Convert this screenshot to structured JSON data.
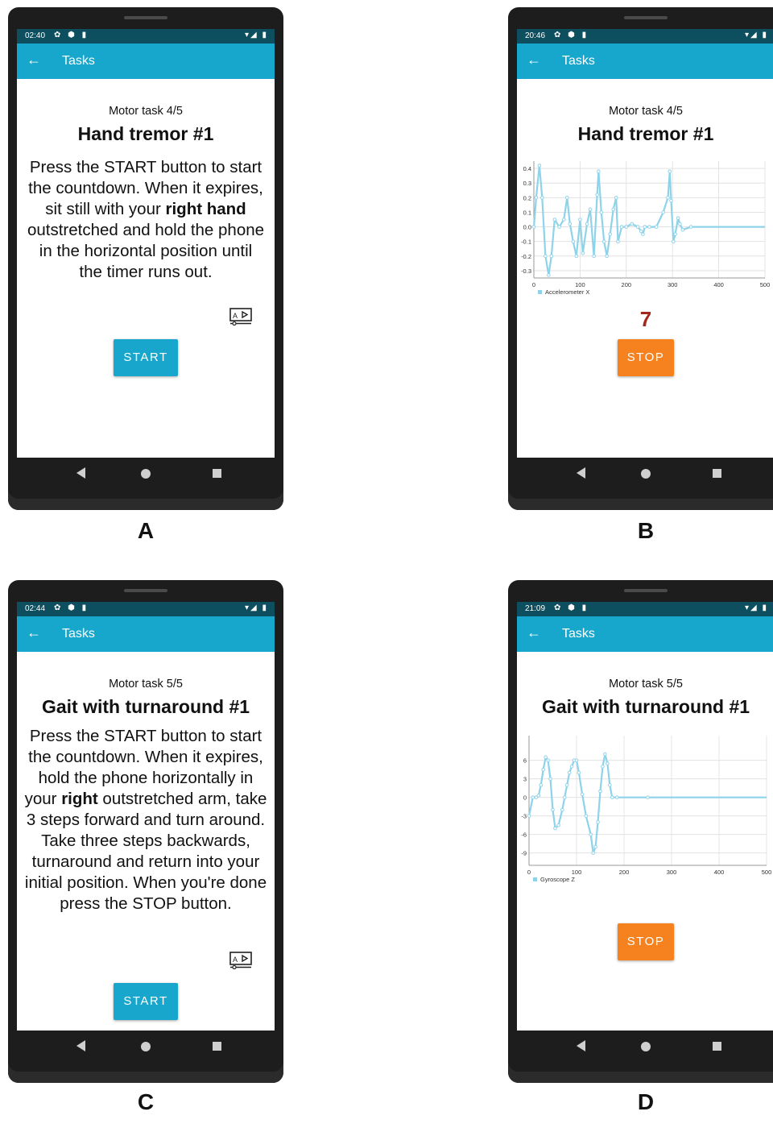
{
  "panels": [
    {
      "label": "A",
      "status_time": "02:40",
      "status_icons": "✿ ⬢ ▮",
      "status_right": "▾◢ ▮",
      "app_title": "Tasks",
      "subtitle": "Motor task 4/5",
      "title": "Hand tremor #1",
      "instruction_html": "Press the START button to start the countdown. When it expires, sit still with your <b>right hand</b> outstretched and hold the phone in the horizontal position until the timer runs out.",
      "button_label": "START"
    },
    {
      "label": "B",
      "status_time": "20:46",
      "status_icons": "✿ ⬢ ▮",
      "status_right": "▾◢ ▮",
      "app_title": "Tasks",
      "subtitle": "Motor task 4/5",
      "title": "Hand tremor #1",
      "countdown": "7",
      "button_label": "STOP"
    },
    {
      "label": "C",
      "status_time": "02:44",
      "status_icons": "✿ ⬢ ▮",
      "status_right": "▾◢ ▮",
      "app_title": "Tasks",
      "subtitle": "Motor task 5/5",
      "title": "Gait with turnaround #1",
      "instruction_html": "Press the START button to start the countdown. When it expires, hold the phone horizontally in your <b>right</b> outstretched arm, take 3 steps forward and turn around. Take three steps backwards, turnaround and return into your initial position. When you're done press the STOP button.",
      "button_label": "START"
    },
    {
      "label": "D",
      "status_time": "21:09",
      "status_icons": "✿ ⬢ ▮",
      "status_right": "▾◢ ▮",
      "app_title": "Tasks",
      "subtitle": "Motor task 5/5",
      "title": "Gait with turnaround #1",
      "button_label": "STOP"
    }
  ],
  "colors": {
    "appbar": "#17a6cc",
    "statusbar": "#0d4f5f",
    "start_button": "#19a6cc",
    "stop_button": "#f6821f",
    "countdown": "#a3291f",
    "series": "#8fd3ea"
  },
  "icons": {
    "back": "arrow-left-icon",
    "video": "video-tutorial-icon"
  },
  "chart_data": [
    {
      "type": "line",
      "panel": "B",
      "series": [
        {
          "name": "Accelerometer X",
          "points": [
            [
              0,
              0.0
            ],
            [
              5,
              0.2
            ],
            [
              12,
              0.42
            ],
            [
              18,
              0.2
            ],
            [
              25,
              -0.2
            ],
            [
              32,
              -0.33
            ],
            [
              38,
              -0.2
            ],
            [
              45,
              0.05
            ],
            [
              55,
              0.0
            ],
            [
              65,
              0.05
            ],
            [
              72,
              0.2
            ],
            [
              78,
              0.02
            ],
            [
              85,
              -0.1
            ],
            [
              92,
              -0.2
            ],
            [
              100,
              0.05
            ],
            [
              106,
              -0.18
            ],
            [
              115,
              0.02
            ],
            [
              122,
              0.12
            ],
            [
              130,
              -0.2
            ],
            [
              137,
              0.22
            ],
            [
              140,
              0.38
            ],
            [
              146,
              0.1
            ],
            [
              152,
              -0.1
            ],
            [
              158,
              -0.2
            ],
            [
              165,
              -0.05
            ],
            [
              172,
              0.12
            ],
            [
              178,
              0.2
            ],
            [
              182,
              -0.1
            ],
            [
              190,
              0.0
            ],
            [
              200,
              0.0
            ],
            [
              212,
              0.02
            ],
            [
              225,
              0.0
            ],
            [
              232,
              -0.03
            ],
            [
              236,
              -0.05
            ],
            [
              240,
              0.0
            ],
            [
              250,
              0.0
            ],
            [
              265,
              0.0
            ],
            [
              280,
              0.1
            ],
            [
              290,
              0.2
            ],
            [
              294,
              0.38
            ],
            [
              297,
              0.18
            ],
            [
              302,
              -0.1
            ],
            [
              306,
              -0.05
            ],
            [
              312,
              0.06
            ],
            [
              316,
              0.02
            ],
            [
              322,
              -0.02
            ],
            [
              340,
              0.0
            ],
            [
              400,
              0.0
            ],
            [
              500,
              0.0
            ]
          ]
        }
      ],
      "xlim": [
        0,
        500
      ],
      "ylim": [
        -0.35,
        0.45
      ],
      "xticks": [
        "0",
        "100",
        "200",
        "300",
        "400",
        "500"
      ],
      "yticks": [
        "0.4",
        "0.3",
        "0.2",
        "0.1",
        "0.0",
        "-0.1",
        "-0.2",
        "-0.3"
      ],
      "ytick_values": [
        0.4,
        0.3,
        0.2,
        0.1,
        0.0,
        -0.1,
        -0.2,
        -0.3
      ],
      "legend_position": "bottom-left",
      "grid": true
    },
    {
      "type": "line",
      "panel": "D",
      "series": [
        {
          "name": "Gyroscope Z",
          "points": [
            [
              0,
              -3
            ],
            [
              8,
              0
            ],
            [
              15,
              0
            ],
            [
              20,
              0.3
            ],
            [
              25,
              2
            ],
            [
              30,
              4.5
            ],
            [
              35,
              6.5
            ],
            [
              40,
              6
            ],
            [
              45,
              3
            ],
            [
              50,
              -2
            ],
            [
              55,
              -5
            ],
            [
              62,
              -4.5
            ],
            [
              70,
              -2
            ],
            [
              75,
              0
            ],
            [
              80,
              2
            ],
            [
              85,
              4
            ],
            [
              90,
              5
            ],
            [
              95,
              6
            ],
            [
              100,
              6
            ],
            [
              105,
              4
            ],
            [
              112,
              0.5
            ],
            [
              120,
              -3
            ],
            [
              130,
              -6
            ],
            [
              135,
              -9
            ],
            [
              140,
              -8
            ],
            [
              145,
              -4
            ],
            [
              150,
              1
            ],
            [
              155,
              5
            ],
            [
              160,
              7
            ],
            [
              165,
              5.5
            ],
            [
              170,
              2
            ],
            [
              175,
              0
            ],
            [
              185,
              0
            ],
            [
              250,
              0
            ],
            [
              350,
              0
            ],
            [
              450,
              0
            ],
            [
              500,
              0
            ]
          ]
        }
      ],
      "xlim": [
        0,
        500
      ],
      "ylim": [
        -11,
        10
      ],
      "xticks": [
        "0",
        "100",
        "200",
        "300",
        "400",
        "500"
      ],
      "yticks": [
        "6",
        "3",
        "0",
        "-3",
        "-6",
        "-9"
      ],
      "ytick_values": [
        6,
        3,
        0,
        -3,
        -6,
        -9
      ],
      "legend_position": "bottom-left",
      "grid": true
    }
  ]
}
